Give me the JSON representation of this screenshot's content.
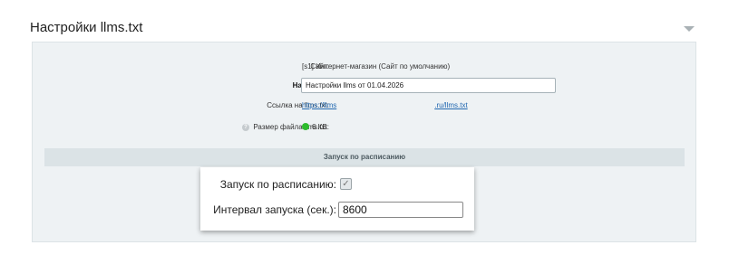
{
  "header": {
    "title": "Настройки llms.txt",
    "collapse_icon": "triangle-down-icon"
  },
  "fields": {
    "site": {
      "label": "Сайт:",
      "value": "[s1] Интернет-магазин (Сайт по умолчанию)"
    },
    "name": {
      "label": "Название:",
      "value": "Настройки llms от 01.04.2026"
    },
    "link": {
      "label": "Ссылка на llms.txt:",
      "value_start": "https://llms",
      "value_end": ".ru/llms.txt"
    },
    "size": {
      "label": "Размер файла llms.txt:",
      "value": "6 КБ",
      "status_color": "#2dbb2d",
      "help_icon": "question-icon"
    }
  },
  "schedule": {
    "section_title": "Запуск по расписанию",
    "enabled_label": "Запуск по расписанию:",
    "enabled": true,
    "interval_label": "Интервал запуска (сек.):",
    "interval_value": "8600"
  }
}
